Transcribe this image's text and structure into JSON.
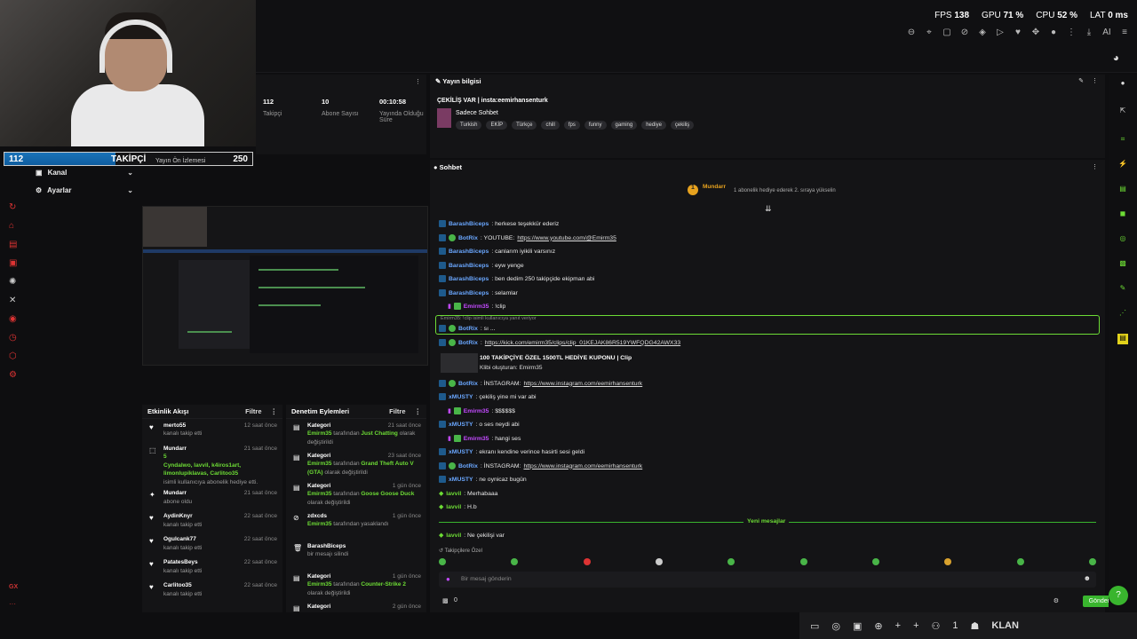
{
  "stats": {
    "fps_label": "FPS",
    "fps": "138",
    "gpu_label": "GPU",
    "gpu": "71 %",
    "cpu_label": "CPU",
    "cpu": "52 %",
    "lat_label": "LAT",
    "lat": "0 ms"
  },
  "top_ai": "AI",
  "follow_goal": {
    "current": "112",
    "label": "TAKİPÇİ",
    "target": "250",
    "fraction": 0.448
  },
  "nav": {
    "kanal": "Kanal",
    "ayarlar": "Ayarlar"
  },
  "channel_stats": [
    {
      "num": "112",
      "label": "Takipçi"
    },
    {
      "num": "10",
      "label": "Abone Sayısı"
    },
    {
      "num": "00:10:58",
      "label": "Yayında Olduğu Süre"
    }
  ],
  "preview_label": "Yayın Ön İzlemesi",
  "info": {
    "header": "Yayın bilgisi",
    "title": "ÇEKİLİŞ VAR | insta:eemirhansenturk",
    "category": "Sadece Sohbet",
    "tags": [
      "Turkish",
      "EKİP",
      "Türkçe",
      "chill",
      "fps",
      "funny",
      "gaming",
      "hediye",
      "çekiliş"
    ]
  },
  "activity": {
    "header": "Etkinlik Akışı",
    "filter": "Filtre",
    "items": [
      {
        "name": "merto55",
        "sub": "kanalı takip etti",
        "time": "12 saat önce"
      },
      {
        "name": "Mundarr",
        "sub": "isimli kullanıcıya abonelik hediye etti.",
        "extra": "5",
        "gifts": "Cyndalwo, lavvil, k4iros1art, limonlupiklavas, Carlitoo35",
        "time": "21 saat önce"
      },
      {
        "name": "Mundarr",
        "sub": "abone oldu",
        "time": "21 saat önce"
      },
      {
        "name": "AydinKnyr",
        "sub": "kanalı takip etti",
        "time": "22 saat önce"
      },
      {
        "name": "Ogulcank77",
        "sub": "kanalı takip etti",
        "time": "22 saat önce"
      },
      {
        "name": "PatatesBeys",
        "sub": "kanalı takip etti",
        "time": "22 saat önce"
      },
      {
        "name": "Carlitoo35",
        "sub": "kanalı takip etti",
        "time": "22 saat önce"
      }
    ]
  },
  "moderation": {
    "header": "Denetim Eylemleri",
    "filter": "Filtre",
    "items": [
      {
        "name": "Kategori",
        "who": "Emirm35",
        "mid": "tarafından",
        "val": "Just Chatting",
        "end": "olarak değiştirildi",
        "time": "21 saat önce"
      },
      {
        "name": "Kategori",
        "who": "Emirm35",
        "mid": "tarafından",
        "val": "Grand Theft Auto V (GTA)",
        "end": "olarak değiştirildi",
        "time": "23 saat önce"
      },
      {
        "name": "Kategori",
        "who": "Emirm35",
        "mid": "tarafından",
        "val": "Goose Goose Duck",
        "end": "olarak değiştirildi",
        "time": "1 gün önce"
      },
      {
        "name": "zdxcds",
        "who": "Emirm35",
        "mid": "tarafından yasaklandı",
        "val": "",
        "end": "",
        "time": "1 gün önce"
      },
      {
        "name": "BarashBiceps",
        "who": "",
        "mid": "bir mesajı silindi",
        "val": "",
        "end": "",
        "time": ""
      },
      {
        "name": "Kategori",
        "who": "Emirm35",
        "mid": "tarafından",
        "val": "Counter-Strike 2",
        "end": "olarak değiştirildi",
        "time": "1 gün önce"
      },
      {
        "name": "Kategori",
        "who": "",
        "mid": "",
        "val": "",
        "end": "",
        "time": "2 gün önce"
      }
    ]
  },
  "chat": {
    "header": "Sohbet",
    "pinned_user": "Mundarr",
    "pinned_text": "1 abonelik hediye ederek 2. sıraya yükselin",
    "reply_context": "Emirm35: !clip isimli kullanıcıya yanıt veriyor",
    "clip_title": "100 TAKİPÇİYE ÖZEL 1500TL HEDİYE KUPONU | Clip",
    "clip_sub": "Klibi oluşturan: Emirm35",
    "new_messages": "Yeni mesajlar",
    "followers_only": "Takipçilere Özel",
    "input_placeholder": "Bir mesaj gönderin",
    "send": "Gönder",
    "count": "0",
    "messages": [
      {
        "user": "BarashBiceps",
        "text": ": herkese teşekkür ederiz"
      },
      {
        "user": "BotRix",
        "text": ": YOUTUBE:",
        "link": "https://www.youtube.com/@Emirm35"
      },
      {
        "user": "BarashBiceps",
        "text": ": canlarım iyikili varsınız"
      },
      {
        "user": "BarashBiceps",
        "text": ": eyw yenge"
      },
      {
        "user": "BarashBiceps",
        "text": ": ben dedim 250 takipçide ekipman abi"
      },
      {
        "user": "BarashBiceps",
        "text": ": selamlar"
      },
      {
        "user": "Emirm35",
        "text": ": !clip"
      },
      {
        "user": "BotRix",
        "text": ": sı ..."
      },
      {
        "user": "BotRix",
        "text": ":",
        "link": "https://kick.com/emirm35/clips/clip_01KEJAK86R519YWFQDG42AWX33"
      },
      {
        "user": "BotRix",
        "text": ": İNSTAGRAM:",
        "link": "https://www.instagram.com/eemirhansenturk"
      },
      {
        "user": "xMUSTY",
        "text": ": çekiliş yine mi var abi"
      },
      {
        "user": "Emirm35",
        "text": ": $$$$$$"
      },
      {
        "user": "xMUSTY",
        "text": ": o ses neydi abi"
      },
      {
        "user": "Emirm35",
        "text": ": hangi ses"
      },
      {
        "user": "xMUSTY",
        "text": ": ekranı kendine verince hasirti sesi geldi"
      },
      {
        "user": "BotRix",
        "text": ": İNSTAGRAM:",
        "link": "https://www.instagram.com/eemirhansenturk"
      },
      {
        "user": "xMUSTY",
        "text": ": ne oynicaz bugün"
      },
      {
        "user": "lavvil",
        "text": ": Merhabaaa"
      },
      {
        "user": "lavvil",
        "text": ": H.b"
      },
      {
        "user": "lavvil",
        "text": ": Ne çekilişi var"
      }
    ]
  },
  "taskbar": {
    "count": "1",
    "klan": "KLAN"
  },
  "gx": "GX"
}
